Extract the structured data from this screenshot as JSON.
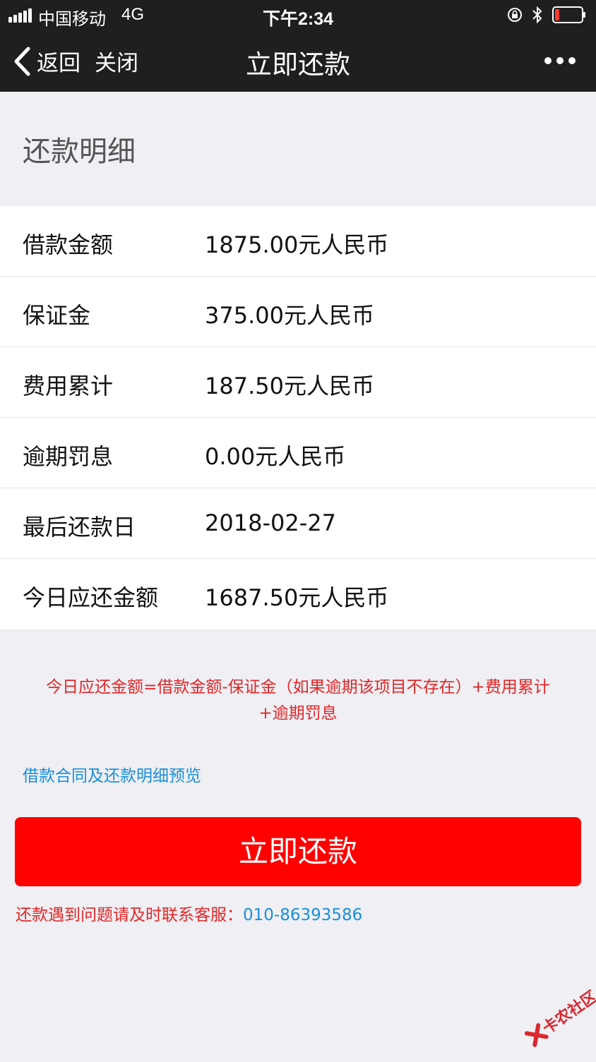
{
  "status_bar": {
    "carrier": "中国移动",
    "network": "4G",
    "time": "下午2:34",
    "battery_color": "#ff3b30"
  },
  "nav": {
    "back_label": "返回",
    "close_label": "关闭",
    "title": "立即还款",
    "more_icon": "more-dots-icon"
  },
  "section_title": "还款明细",
  "details": [
    {
      "label": "借款金额",
      "value": "1875.00元人民币"
    },
    {
      "label": "保证金",
      "value": "375.00元人民币"
    },
    {
      "label": "费用累计",
      "value": "187.50元人民币"
    },
    {
      "label": "逾期罚息",
      "value": "0.00元人民币"
    },
    {
      "label": "最后还款日",
      "value": "2018-02-27"
    },
    {
      "label": "今日应还金额",
      "value": "1687.50元人民币"
    }
  ],
  "formula_line1": "今日应还金额=借款金额-保证金（如果逾期该项目不存在）+费用累计",
  "formula_line2": "+逾期罚息",
  "preview_link": "借款合同及还款明细预览",
  "pay_button": "立即还款",
  "contact_text": "还款遇到问题请及时联系客服：",
  "contact_phone": "010-86393586",
  "watermark_text": "卡农社区",
  "colors": {
    "nav_bg": "#1f1f1f",
    "button_red": "#ff0000",
    "warning_red": "#e02727",
    "link_blue": "#1a8fd8",
    "page_bg": "#efeff4"
  }
}
